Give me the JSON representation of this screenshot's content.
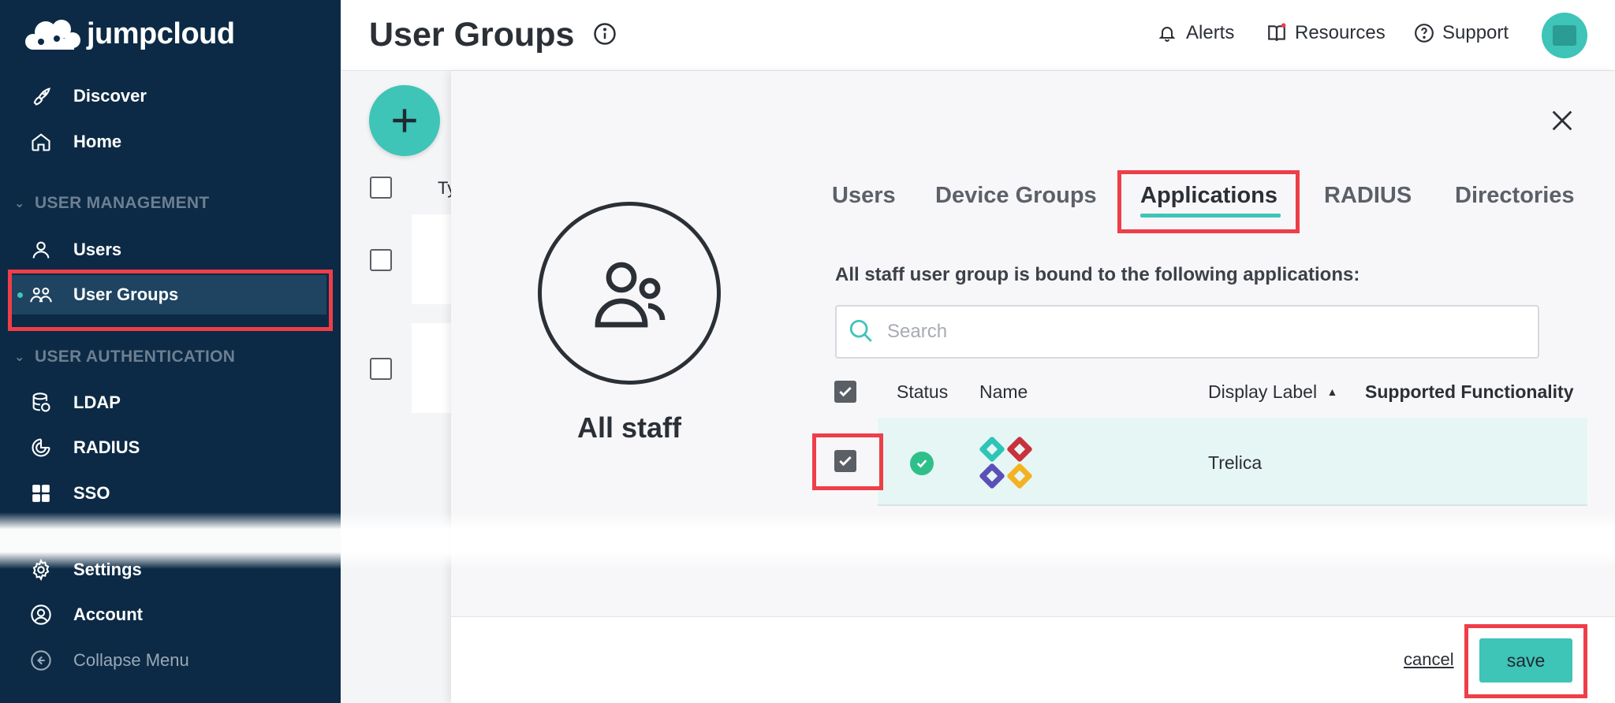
{
  "sidebar": {
    "logo_text": "jumpcloud",
    "items": [
      {
        "label": "Discover"
      },
      {
        "label": "Home"
      },
      {
        "label": "Users"
      },
      {
        "label": "User Groups"
      },
      {
        "label": "LDAP"
      },
      {
        "label": "RADIUS"
      },
      {
        "label": "SSO"
      },
      {
        "label": "Settings"
      },
      {
        "label": "Account"
      },
      {
        "label": "Collapse Menu"
      }
    ],
    "sections": {
      "user_management": "USER MANAGEMENT",
      "user_authentication": "USER AUTHENTICATION"
    }
  },
  "header": {
    "title": "User Groups",
    "alerts": "Alerts",
    "resources": "Resources",
    "support": "Support"
  },
  "background": {
    "type_header_partial": "Ty"
  },
  "panel": {
    "group_name": "All staff",
    "tabs": [
      "Users",
      "Device Groups",
      "Applications",
      "RADIUS",
      "Directories"
    ],
    "active_tab": "Applications",
    "bound_text": "All staff user group is bound to the following applications:",
    "search_placeholder": "Search",
    "table": {
      "headers": {
        "status": "Status",
        "name": "Name",
        "display_label": "Display Label",
        "supported": "Supported Functionality"
      },
      "rows": [
        {
          "display_label": "Trelica",
          "status": "active",
          "selected": true
        }
      ]
    },
    "cancel_label": "cancel",
    "save_label": "save"
  },
  "colors": {
    "sidebar_bg": "#0c2a45",
    "accent": "#3fc4b8",
    "highlight": "#ee3e48",
    "status_ok": "#2fbf8a"
  }
}
